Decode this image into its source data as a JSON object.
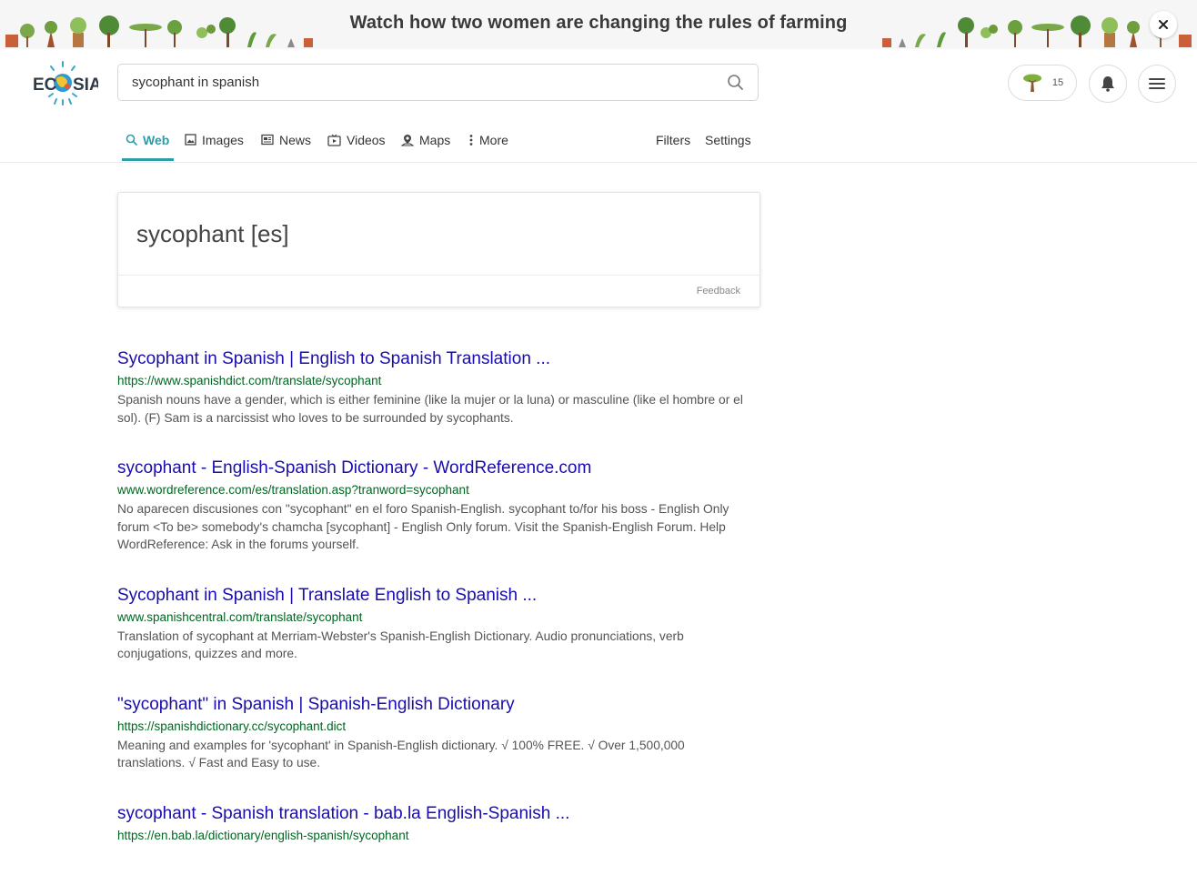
{
  "banner": {
    "text": "Watch how two women are changing the rules of farming",
    "close_icon": "close-icon"
  },
  "header": {
    "logo_text": "ECOSIA",
    "search": {
      "value": "sycophant in spanish",
      "placeholder": ""
    },
    "tree_count": "15",
    "icons": [
      "tree-icon",
      "bell-icon",
      "menu-icon",
      "search-icon"
    ]
  },
  "nav": {
    "tabs": [
      {
        "label": "Web",
        "icon": "search-icon",
        "active": true
      },
      {
        "label": "Images",
        "icon": "image-icon"
      },
      {
        "label": "News",
        "icon": "news-icon"
      },
      {
        "label": "Videos",
        "icon": "video-icon"
      },
      {
        "label": "Maps",
        "icon": "map-pin-icon"
      },
      {
        "label": "More",
        "icon": "more-vertical-icon"
      }
    ],
    "filters_label": "Filters",
    "settings_label": "Settings",
    "accent_color": "#2d9da6"
  },
  "dictionary": {
    "term": "sycophant [es]",
    "feedback_label": "Feedback"
  },
  "results": [
    {
      "title": "Sycophant in Spanish | English to Spanish Translation ...",
      "url": "https://www.spanishdict.com/translate/sycophant",
      "snippet": "Spanish nouns have a gender, which is either feminine (like la mujer or la luna) or masculine (like el hombre or el sol). (F) Sam is a narcissist who loves to be surrounded by sycophants."
    },
    {
      "title": "sycophant - English-Spanish Dictionary - WordReference.com",
      "url": "www.wordreference.com/es/translation.asp?tranword=sycophant",
      "snippet": "No aparecen discusiones con \"sycophant\" en el foro Spanish-English. sycophant to/for his boss - English Only forum <To be> somebody's chamcha [sycophant] - English Only forum. Visit the Spanish-English Forum. Help WordReference: Ask in the forums yourself."
    },
    {
      "title": "Sycophant in Spanish | Translate English to Spanish ...",
      "url": "www.spanishcentral.com/translate/sycophant",
      "snippet": "Translation of sycophant at Merriam-Webster's Spanish-English Dictionary. Audio pronunciations, verb conjugations, quizzes and more."
    },
    {
      "title": "\"sycophant\" in Spanish | Spanish-English Dictionary",
      "url": "https://spanishdictionary.cc/sycophant.dict",
      "snippet": "Meaning and examples for 'sycophant' in Spanish-English dictionary. √ 100% FREE. √ Over 1,500,000 translations. √ Fast and Easy to use."
    },
    {
      "title": "sycophant - Spanish translation - bab.la English-Spanish ...",
      "url": "https://en.bab.la/dictionary/english-spanish/sycophant",
      "snippet": ""
    }
  ],
  "colors": {
    "link_title": "#1a0dab",
    "link_url": "#006621",
    "snippet": "#545454"
  }
}
